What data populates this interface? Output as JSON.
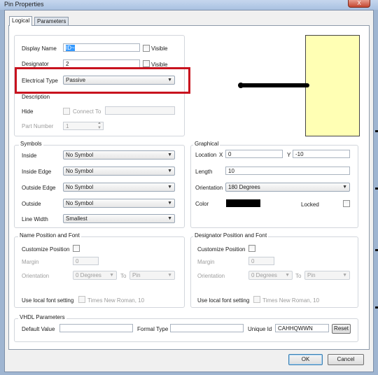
{
  "window": {
    "title": "Pin Properties",
    "close_glyph": "X"
  },
  "tabs": [
    "Logical",
    "Parameters"
  ],
  "logical": {
    "display_name": {
      "label": "Display Name",
      "value": "ID~",
      "visible_label": "Visible"
    },
    "designator": {
      "label": "Designator",
      "value": "2",
      "visible_label": "Visible"
    },
    "electrical_type": {
      "label": "Electrical Type",
      "value": "Passive"
    },
    "description": {
      "label": "Description"
    },
    "hide": {
      "label": "Hide",
      "connect_to_label": "Connect To"
    },
    "part_number": {
      "label": "Part Number",
      "value": "1"
    }
  },
  "symbols": {
    "title": "Symbols",
    "rows": [
      {
        "label": "Inside",
        "value": "No Symbol"
      },
      {
        "label": "Inside Edge",
        "value": "No Symbol"
      },
      {
        "label": "Outside Edge",
        "value": "No Symbol"
      },
      {
        "label": "Outside",
        "value": "No Symbol"
      },
      {
        "label": "Line Width",
        "value": "Smallest"
      }
    ]
  },
  "graphical": {
    "title": "Graphical",
    "location_label": "Location",
    "x_label": "X",
    "x_value": "0",
    "y_label": "Y",
    "y_value": "-10",
    "length_label": "Length",
    "length_value": "10",
    "orientation_label": "Orientation",
    "orientation_value": "180 Degrees",
    "color_label": "Color",
    "color": "#000000",
    "locked_label": "Locked"
  },
  "name_position": {
    "title": "Name Position and Font",
    "customize_label": "Customize Position",
    "margin_label": "Margin",
    "margin_value": "0",
    "orientation_label": "Orientation",
    "orientation_value": "0 Degrees",
    "to_label": "To",
    "to_value": "Pin",
    "font_label": "Use local font setting",
    "font_value": "Times New Roman, 10"
  },
  "designator_position": {
    "title": "Designator Position and Font",
    "customize_label": "Customize Position",
    "margin_label": "Margin",
    "margin_value": "0",
    "orientation_label": "Orientation",
    "orientation_value": "0 Degrees",
    "to_label": "To",
    "to_value": "Pin",
    "font_label": "Use local font setting",
    "font_value": "Times New Roman, 10"
  },
  "vhdl": {
    "title": "VHDL Parameters",
    "default_value_label": "Default Value",
    "formal_type_label": "Formal Type",
    "unique_id_label": "Unique Id",
    "unique_id_value": "CAHHQWWN",
    "reset_label": "Reset"
  },
  "footer": {
    "ok_label": "OK",
    "cancel_label": "Cancel"
  },
  "colors": {
    "highlight": "#c8121e",
    "preview_fill": "#ffffb4",
    "pin_color": "#000000"
  }
}
